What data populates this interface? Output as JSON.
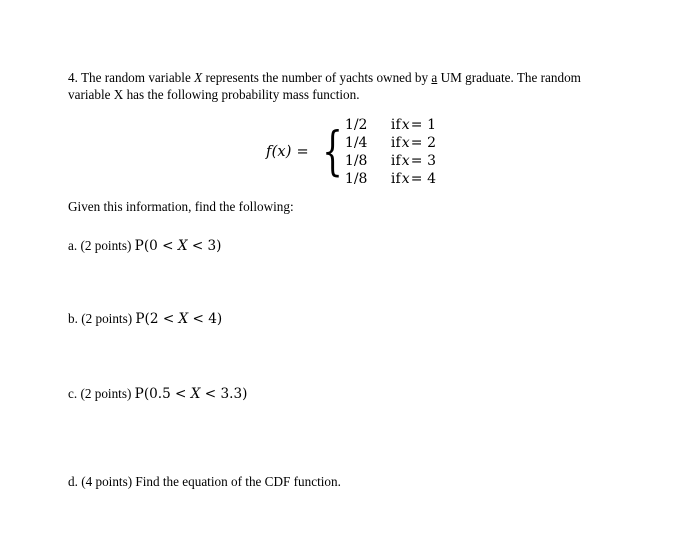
{
  "document": {
    "question_number": "4.",
    "intro": {
      "before_var": "4. The random variable ",
      "var1": "X",
      "mid1": " represents the number of yachts owned by ",
      "flagged_word": "a",
      "mid2": " UM graduate.  The random variable X has the following probability mass function.",
      "full_text": "4. The random variable X represents the number of yachts owned by a UM graduate.  The random variable X has the following probability mass function."
    },
    "pmf": {
      "lhs": "f(x) =",
      "rows": [
        {
          "value": "1/2",
          "if_label": "if",
          "variable": "x",
          "equals": "= 1",
          "condition": "if x = 1"
        },
        {
          "value": "1/4",
          "if_label": "if",
          "variable": "x",
          "equals": "= 2",
          "condition": "if x = 2"
        },
        {
          "value": "1/8",
          "if_label": "if",
          "variable": "x",
          "equals": "= 3",
          "condition": "if x = 3"
        },
        {
          "value": "1/8",
          "if_label": "if",
          "variable": "x",
          "equals": "= 4",
          "condition": "if x = 4"
        }
      ]
    },
    "given_line": "Given this information, find the following:",
    "parts": [
      {
        "label": "a. (2 points) ",
        "expr_prefix": "P(0 < ",
        "expr_var": "X",
        "expr_suffix": " < 3)",
        "points": "2 points",
        "full_text": "a. (2 points) P(0 < X < 3)"
      },
      {
        "label": "b. (2 points) ",
        "expr_prefix": "P(2 < ",
        "expr_var": "X",
        "expr_suffix": " < 4)",
        "points": "2 points",
        "full_text": "b. (2 points) P(2 < X < 4)"
      },
      {
        "label": "c. (2 points) ",
        "expr_prefix": "P(0.5 < ",
        "expr_var": "X",
        "expr_suffix": " < 3.3)",
        "points": "2 points",
        "full_text": "c. (2 points) P(0.5 < X < 3.3)"
      },
      {
        "label": "d. (4 points) Find the equation of the CDF function.",
        "expr_prefix": "",
        "expr_var": "",
        "expr_suffix": "",
        "points": "4 points",
        "full_text": "d. (4 points) Find the equation of the CDF function."
      }
    ],
    "colors": {
      "text": "#000000",
      "background": "#ffffff"
    }
  }
}
